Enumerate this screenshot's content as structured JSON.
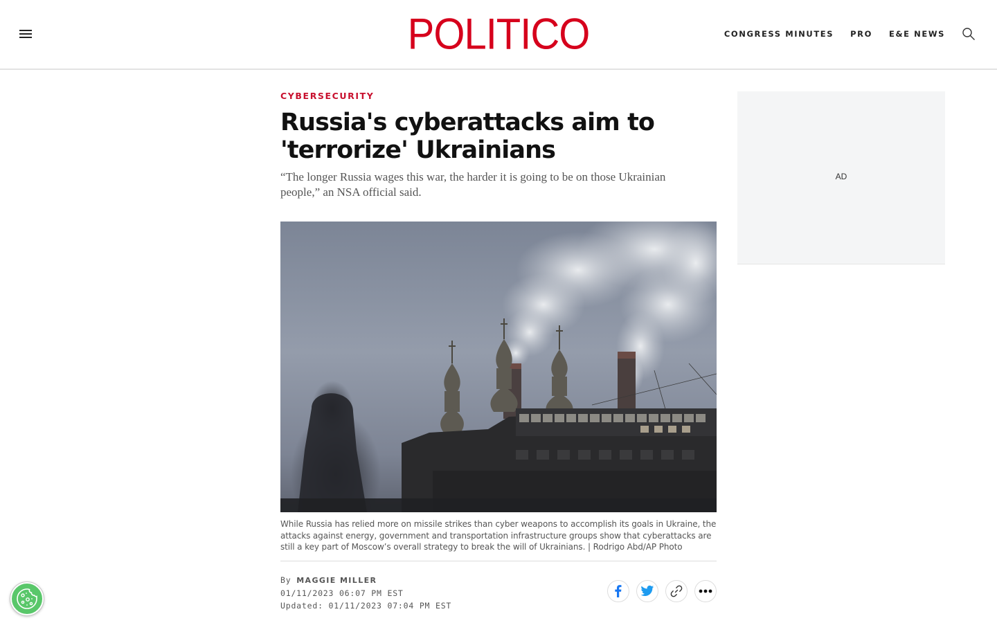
{
  "header": {
    "logo_text": "POLITICO",
    "nav": [
      "CONGRESS MINUTES",
      "PRO",
      "E&E NEWS"
    ],
    "brand_color": "#d6001c"
  },
  "article": {
    "category": "CYBERSECURITY",
    "headline": "Russia's cyberattacks aim to 'terrorize' Ukrainians",
    "dek": "“The longer Russia wages this war, the harder it is going to be on those Ukrainian people,” an NSA official said.",
    "caption": "While Russia has relied more on missile strikes than cyber weapons to accomplish its goals in Ukraine, the attacks against energy, government and transportation infrastructure groups show that cyberattacks are still a key part of Moscow’s overall strategy to break the will of Ukrainians. | Rodrigo Abd/AP Photo",
    "byline_prefix": "By",
    "author": "MAGGIE MILLER",
    "published": "01/11/2023 06:07 PM EST",
    "updated": "Updated: 01/11/2023 07:04 PM EST"
  },
  "share": {
    "icons": [
      "facebook-icon",
      "twitter-icon",
      "link-icon",
      "more-icon"
    ],
    "facebook_color": "#1877f2",
    "twitter_color": "#1d9bf0"
  },
  "ad": {
    "label": "AD"
  },
  "colors": {
    "category": "#c8102e",
    "cookie_button": "#59c76a"
  }
}
